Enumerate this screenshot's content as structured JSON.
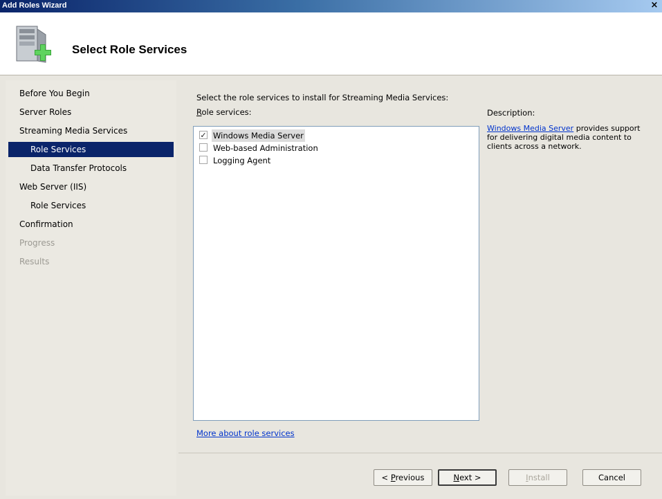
{
  "window": {
    "title": "Add Roles Wizard",
    "close_glyph": "×"
  },
  "header": {
    "title": "Select Role Services",
    "icon": "server-add-icon"
  },
  "nav": {
    "items": [
      {
        "label": "Before You Begin",
        "state": "normal",
        "sub": false
      },
      {
        "label": "Server Roles",
        "state": "normal",
        "sub": false
      },
      {
        "label": "Streaming Media Services",
        "state": "normal",
        "sub": false
      },
      {
        "label": "Role Services",
        "state": "selected",
        "sub": true
      },
      {
        "label": "Data Transfer Protocols",
        "state": "normal",
        "sub": true
      },
      {
        "label": "Web Server (IIS)",
        "state": "normal",
        "sub": false
      },
      {
        "label": "Role Services",
        "state": "normal",
        "sub": true
      },
      {
        "label": "Confirmation",
        "state": "normal",
        "sub": false
      },
      {
        "label": "Progress",
        "state": "disabled",
        "sub": false
      },
      {
        "label": "Results",
        "state": "disabled",
        "sub": false
      }
    ]
  },
  "content": {
    "instruction": "Select the role services to install for Streaming Media Services:",
    "role_services_label_accel": "R",
    "role_services_label_rest": "ole services:",
    "services": [
      {
        "label": "Windows Media Server",
        "checked": true,
        "selected": true
      },
      {
        "label": "Web-based Administration",
        "checked": false,
        "selected": false
      },
      {
        "label": "Logging Agent",
        "checked": false,
        "selected": false
      }
    ],
    "description_title": "Description:",
    "description_link": "Windows Media Server",
    "description_text": " provides support for delivering digital media content to clients across a network.",
    "more_link": "More about role services"
  },
  "buttons": {
    "previous_pre": "< ",
    "previous_accel": "P",
    "previous_rest": "revious",
    "next_accel": "N",
    "next_rest": "ext >",
    "install_accel": "I",
    "install_rest": "nstall",
    "cancel": "Cancel"
  }
}
